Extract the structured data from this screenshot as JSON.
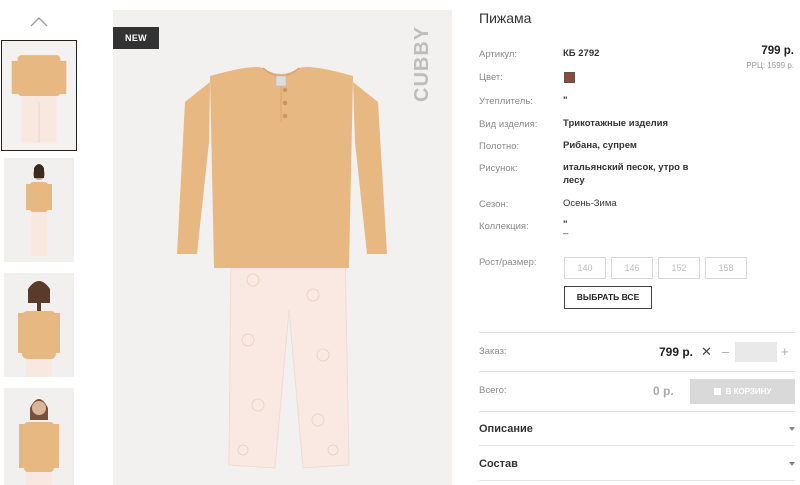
{
  "product": {
    "title": "Пижама",
    "badge": "NEW",
    "brand_mark": "CUBBY",
    "price": "799 р.",
    "rrp": "РРЦ: 1599 р.",
    "color_hex": "#8b4a3a"
  },
  "specs": {
    "article_label": "Артикул:",
    "article_value": "КБ 2792",
    "color_label": "Цвет:",
    "insulation_label": "Утеплитель:",
    "insulation_value": "\"",
    "type_label": "Вид изделия:",
    "type_value": "Трикотажные изделия",
    "fabric_label": "Полотно:",
    "fabric_value": "Рибана, супрем",
    "pattern_label": "Рисунок:",
    "pattern_value_1": "итальянский песок, утро в",
    "pattern_value_2": "лесу",
    "season_label": "Сезон:",
    "season_value": "Осень-Зима",
    "collection_label": "Коллекция:",
    "collection_value_1": "\"",
    "collection_value_2": "–"
  },
  "sizes": {
    "label": "Рост/размер:",
    "options": [
      "140",
      "146",
      "152",
      "158"
    ],
    "select_all": "ВЫБРАТЬ ВСЕ"
  },
  "order": {
    "label": "Заказ:",
    "price": "799 р.",
    "times": "✕",
    "minus": "–",
    "plus": "+",
    "qty": ""
  },
  "total": {
    "label": "Всего:",
    "value": "0 р.",
    "cart_button": "В КОРЗИНУ"
  },
  "accordion": {
    "description": "Описание",
    "composition": "Состав"
  },
  "colors": {
    "top": "#e8b882",
    "pants": "#f8e8e0",
    "frame_bg": "#f2f1ef"
  }
}
